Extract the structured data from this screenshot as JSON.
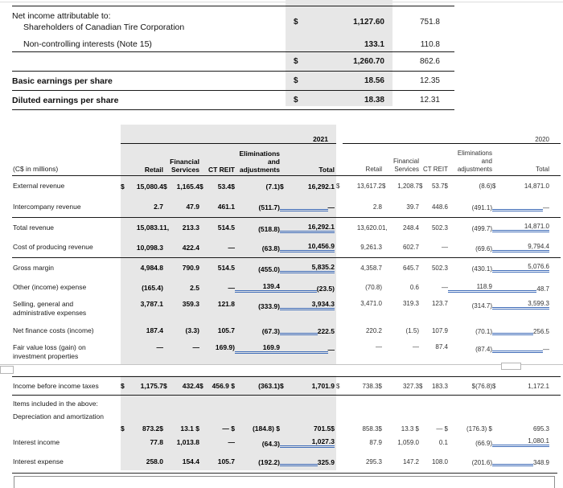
{
  "top_table": {
    "rows": [
      {
        "label": "Net income attributable to:",
        "label2": "Shareholders of Canadian Tire Corporation",
        "v2021": "$|1,127.60",
        "v2020": "751.8",
        "cls": "h38"
      },
      {
        "label": "",
        "label2": "Non-controlling interests (Note 15)",
        "v2021": "133.1",
        "v2020": "110.8",
        "cls": "h18"
      },
      {
        "label": "",
        "label2": "",
        "v2021": "$|1,260.70",
        "v2020": "862.6",
        "cls": "h23 line-above"
      },
      {
        "label": "Basic earnings per share",
        "label2": "",
        "v2021": "$|18.56",
        "v2020": "12.35",
        "cls": "h23 bold line-above"
      },
      {
        "label": "Diluted earnings per share",
        "label2": "",
        "v2021": "$|18.38",
        "v2020": "12.31",
        "cls": "h23 bold line-above line-below"
      }
    ]
  },
  "segment_table": {
    "units_label": "(C$ in millions)",
    "year1": "2021",
    "year2": "2020",
    "columns": [
      "Retail",
      "Financial\nServices",
      "CT REIT",
      "Eliminations\nand\nadjustments",
      "Total"
    ],
    "rows": [
      {
        "key": "ext",
        "label": "External revenue",
        "label2": "",
        "cls": "",
        "y1": {
          "r": "$|15,080.4",
          "f": "$|1,165.4",
          "c": "$|53.4$",
          "e": "(7.1)",
          "t": "$|16,292.1",
          "u": ""
        },
        "y2": {
          "r": "$|13,617.2",
          "f": "$|1,208.7",
          "c": "$|53.7$",
          "e": "(8.6)",
          "t": "$|14,871.0",
          "u": ""
        }
      },
      {
        "key": "inter",
        "label": "Intercompany revenue",
        "label2": "",
        "cls": "r-inter",
        "y1": {
          "r": "2.7",
          "f": "47.9",
          "c": "461.1",
          "e": "(511.7)",
          "t": "—",
          "u": "g"
        },
        "y2": {
          "r": "2.8",
          "f": "39.7",
          "c": "448.6",
          "e": "(491.1)",
          "t": "—",
          "u": "g"
        }
      },
      {
        "key": "trev",
        "label": "Total revenue",
        "label2": "",
        "cls": "line-above",
        "y1": {
          "r": "15,083.1",
          "f": "1,|213.3",
          "c": "514.5",
          "e": "(518.8)",
          "t": "16,292.1",
          "u": "gt"
        },
        "y2": {
          "r": "13,620.0",
          "f": "1,|248.4",
          "c": "502.3",
          "e": "(499.7)",
          "t": "14,871.0",
          "u": "gt"
        }
      },
      {
        "key": "cost",
        "label": "Cost of producing revenue",
        "label2": "",
        "cls": "",
        "y1": {
          "r": "10,098.3",
          "f": "422.4",
          "c": "—",
          "e": "(63.8)",
          "t": "10,456.9",
          "u": "gt"
        },
        "y2": {
          "r": "9,261.3",
          "f": "602.7",
          "c": "—",
          "e": "(69.6)",
          "t": "9,794.4",
          "u": "gt"
        }
      },
      {
        "key": "gross",
        "label": "Gross margin",
        "label2": "",
        "cls": "line-above",
        "y1": {
          "r": "4,984.8",
          "f": "790.9",
          "c": "514.5",
          "e": "(455.0)",
          "t": "5,835.2",
          "u": "gt"
        },
        "y2": {
          "r": "4,358.7",
          "f": "645.7",
          "c": "502.3",
          "e": "(430.1)",
          "t": "5,076.6",
          "u": "gt"
        }
      },
      {
        "key": "other",
        "label": "Other (income) expense",
        "label2": "",
        "cls": "",
        "y1": {
          "r": "(165.4)",
          "f": "2.5",
          "c": "—",
          "e": "139.4",
          "t": "(23.5)",
          "u": "eg"
        },
        "y2": {
          "r": "(70.8)",
          "f": "0.6",
          "c": "—",
          "e": "118.9",
          "t": "48.7",
          "u": "eg"
        }
      },
      {
        "key": "sga",
        "label": "Selling, general and",
        "label2": "administrative expenses",
        "cls": "r-sga top-align",
        "y1": {
          "r": "3,787.1",
          "f": "359.3",
          "c": "121.8",
          "e": "(333.9)",
          "t": "3,934.3",
          "u": "gt"
        },
        "y2": {
          "r": "3,471.0",
          "f": "319.3",
          "c": "123.7",
          "e": "(314.7)",
          "t": "3,599.3",
          "u": "gt"
        }
      },
      {
        "key": "netfin",
        "label": "Net finance costs (income)",
        "label2": "",
        "cls": "r-netfin",
        "y1": {
          "r": "187.4",
          "f": "(3.3)",
          "c": "105.7",
          "e": "(67.3)",
          "t": "222.5",
          "u": "g"
        },
        "y2": {
          "r": "220.2",
          "f": "(1.5)",
          "c": "107.9",
          "e": "(70.1)",
          "t": "256.5",
          "u": "g"
        }
      },
      {
        "key": "fair",
        "label": "Fair value loss (gain) on",
        "label2": "investment properties",
        "cls": "r-fair top-align",
        "y1": {
          "r": "—",
          "f": "—",
          "c": "169.9)",
          "e": "169.9",
          "t": "—",
          "u": "eg"
        },
        "y2": {
          "r": "—",
          "f": "—",
          "c": "87.4",
          "e": "(87.4)",
          "t": "—",
          "u": "g"
        }
      },
      {
        "key": "thin",
        "label": "",
        "label2": "",
        "cls": "r-thin thin",
        "y1": null,
        "y2": null
      },
      {
        "key": "income",
        "label": "Income before income taxes",
        "label2": "",
        "cls": "r-income line-above line-below",
        "y1": {
          "r": "$|1,175.7",
          "f": "$|432.4",
          "c": "$|456.9 $",
          "e": "(363.1)",
          "t": "$|1,701.9",
          "u": ""
        },
        "y2": {
          "r": "$|738.3$",
          "f": "327.3",
          "c": "$|183.3",
          "e": "$|(76.8)",
          "t": "$|1,172.1",
          "u": ""
        }
      },
      {
        "key": "items",
        "label": "Items included in the above:",
        "label2": "",
        "cls": "r-items",
        "y1": null,
        "y2": null
      },
      {
        "key": "dep",
        "label": "Depreciation and amortization",
        "label2": "",
        "cls": "r-dep",
        "y1": {
          "r": "$|873.2$",
          "f": "13.1 $",
          "c": "— $",
          "e": "(184.8) $",
          "t": "701.5$",
          "u": ""
        },
        "y2": {
          "r": "858.3$",
          "f": "13.3 $",
          "c": "— $",
          "e": "(176.3) $",
          "t": "695.3",
          "u": ""
        }
      },
      {
        "key": "intinc",
        "label": "Interest income",
        "label2": "",
        "cls": "r-intinc",
        "y1": {
          "r": "77.8",
          "f": "1,013.8",
          "c": "—",
          "e": "(64.3)",
          "t": "1,027.3",
          "u": "gt"
        },
        "y2": {
          "r": "87.9",
          "f": "1,059.0",
          "c": "0.1",
          "e": "(66.9)",
          "t": "1,080.1",
          "u": "gt"
        }
      },
      {
        "key": "intexp",
        "label": "Interest expense",
        "label2": "",
        "cls": "r-intexp",
        "y1": {
          "r": "258.0",
          "f": "154.4",
          "c": "105.7",
          "e": "(192.2)",
          "t": "325.9",
          "u": "g"
        },
        "y2": {
          "r": "295.3",
          "f": "147.2",
          "c": "108.0",
          "e": "(201.6)",
          "t": "348.9",
          "u": "g"
        }
      }
    ]
  }
}
